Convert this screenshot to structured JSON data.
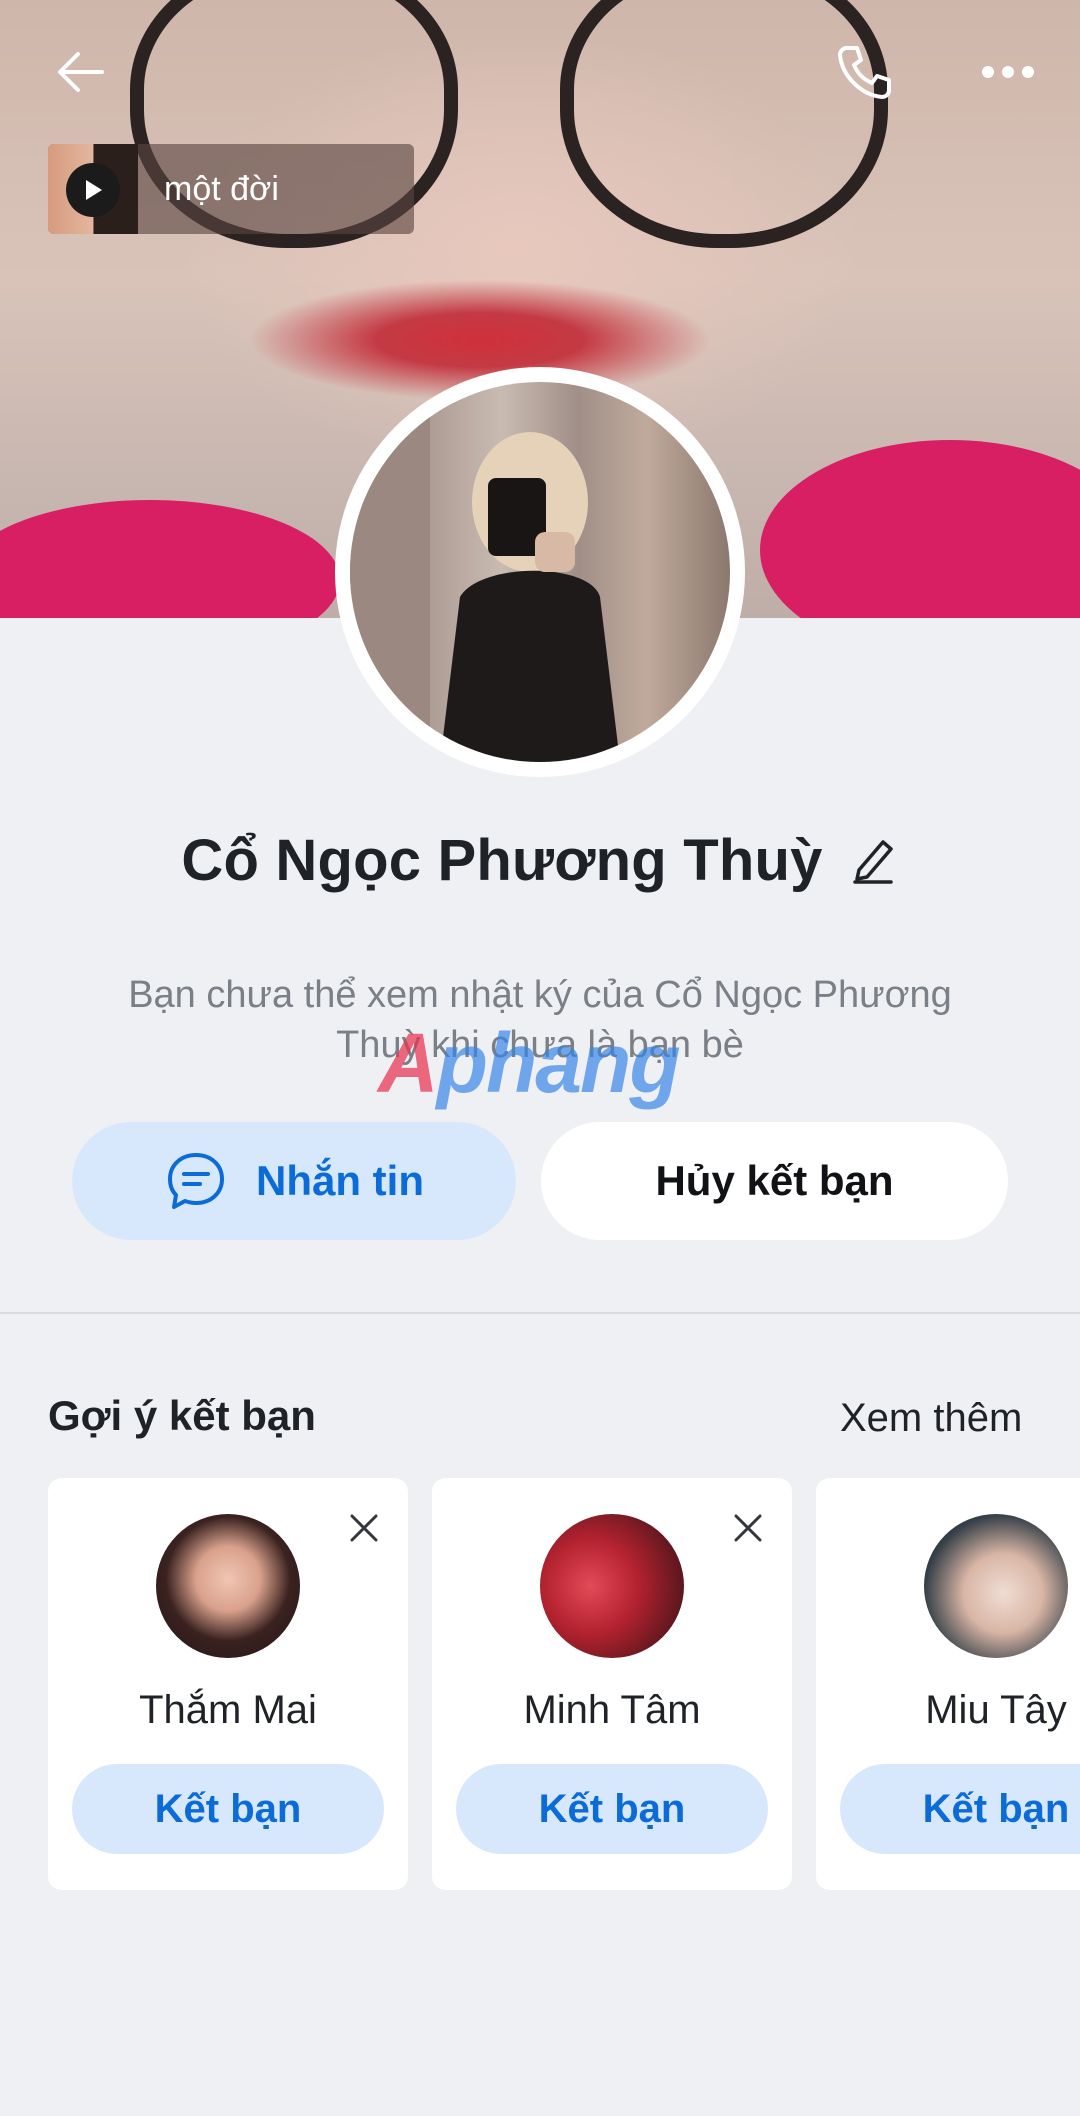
{
  "header": {
    "back_icon": "arrow-left-icon",
    "call_icon": "phone-icon",
    "more_icon": "more-horizontal-icon"
  },
  "music": {
    "title": "một đời",
    "icon": "play-icon"
  },
  "profile": {
    "name": "Cổ Ngọc Phương Thuỳ",
    "edit_icon": "pencil-icon",
    "notice": "Bạn chưa thể xem nhật ký của Cổ Ngọc Phương Thuỳ khi chưa là bạn bè"
  },
  "watermark": {
    "text_first": "A",
    "text_rest": "phang"
  },
  "actions": {
    "message_label": "Nhắn tin",
    "message_icon": "chat-bubble-icon",
    "unfriend_label": "Hủy kết bạn"
  },
  "suggestions": {
    "title": "Gợi ý kết bạn",
    "see_more": "Xem thêm",
    "items": [
      {
        "name": "Thắm Mai",
        "button": "Kết bạn"
      },
      {
        "name": "Minh Tâm",
        "button": "Kết bạn"
      },
      {
        "name": "Miu Tây",
        "button": "Kết bạn"
      }
    ]
  },
  "colors": {
    "accent": "#0b6bd9",
    "accent_bg": "#d7e8fd",
    "page_bg": "#eff0f4"
  }
}
